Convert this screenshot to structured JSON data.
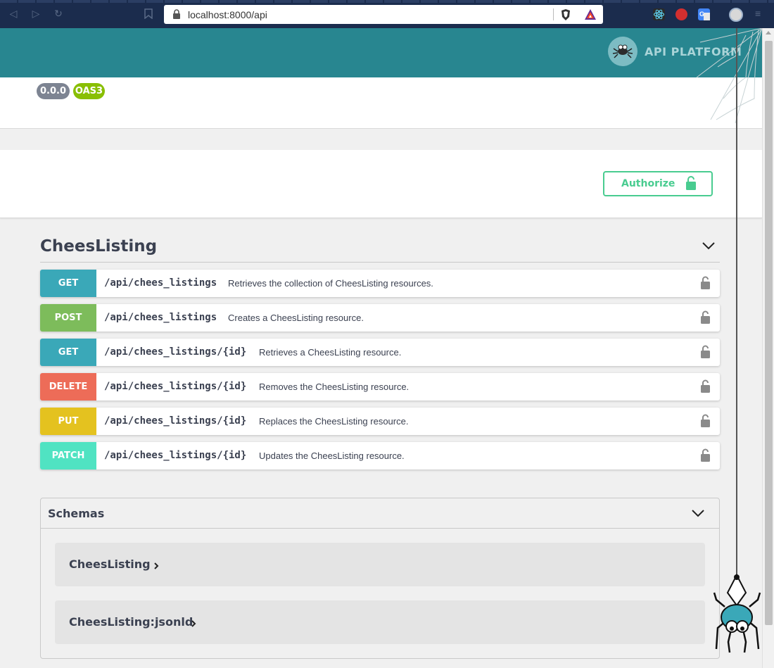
{
  "browser": {
    "url": "localhost:8000/api"
  },
  "header": {
    "logo_text": "API PLATFORM"
  },
  "info": {
    "version_badge": "0.0.0",
    "oas_badge": "OAS3"
  },
  "auth": {
    "authorize_label": "Authorize"
  },
  "tag": {
    "title": "CheesListing",
    "operations": [
      {
        "method": "GET",
        "path": "/api/chees_listings",
        "summary": "Retrieves the collection of CheesListing resources.",
        "color": "#3aa8b8"
      },
      {
        "method": "POST",
        "path": "/api/chees_listings",
        "summary": "Creates a CheesListing resource.",
        "color": "#7dbc5b"
      },
      {
        "method": "GET",
        "path": "/api/chees_listings/{id}",
        "summary": "Retrieves a CheesListing resource.",
        "color": "#3aa8b8"
      },
      {
        "method": "DELETE",
        "path": "/api/chees_listings/{id}",
        "summary": "Removes the CheesListing resource.",
        "color": "#ed6c58"
      },
      {
        "method": "PUT",
        "path": "/api/chees_listings/{id}",
        "summary": "Replaces the CheesListing resource.",
        "color": "#e4c21f"
      },
      {
        "method": "PATCH",
        "path": "/api/chees_listings/{id}",
        "summary": "Updates the CheesListing resource.",
        "color": "#50e3c2"
      }
    ]
  },
  "schemas": {
    "title": "Schemas",
    "models": [
      {
        "name": "CheesListing"
      },
      {
        "name": "CheesListing:jsonld"
      }
    ]
  },
  "colors": {
    "header_bg": "#288690",
    "authorize": "#49cc90",
    "text": "#3b4151"
  }
}
